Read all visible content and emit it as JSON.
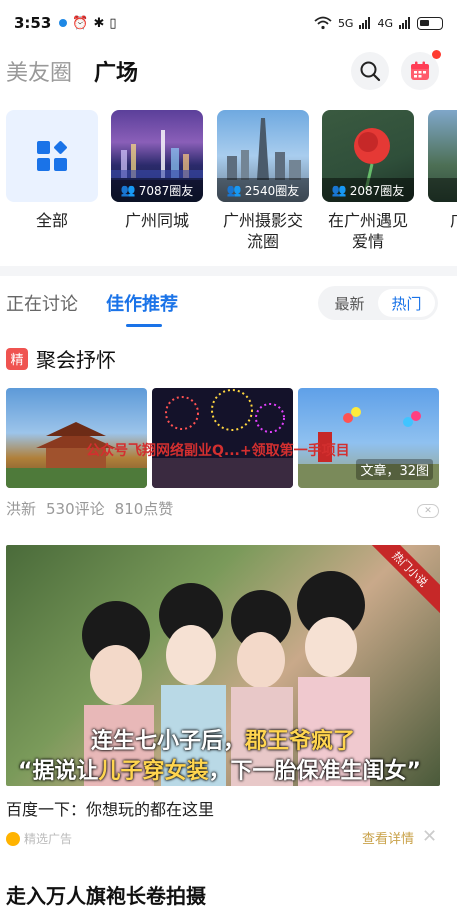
{
  "status_bar": {
    "time": "3:53",
    "network_5g": "5G",
    "network_4g": "4G"
  },
  "header": {
    "tab_friends": "美友圈",
    "tab_square": "广场"
  },
  "circles": [
    {
      "label": "全部",
      "count": ""
    },
    {
      "label": "广州同城",
      "count": "7087圈友"
    },
    {
      "label": "广州摄影交流圈",
      "count": "2540圈友"
    },
    {
      "label": "在广州遇见爱情",
      "count": "2087圈友"
    },
    {
      "label": "广州诗",
      "count": ""
    }
  ],
  "subtabs": {
    "discussing": "正在讨论",
    "featured": "佳作推荐",
    "sort_latest": "最新",
    "sort_hot": "热门"
  },
  "post": {
    "badge": "精",
    "title": "聚会抒怀",
    "overlay_text": "公众号飞翔网络副业Q...+领取第一手项目",
    "image_count": "文章，32图",
    "author": "洪新",
    "comments": "530评论",
    "likes": "810点赞"
  },
  "ad": {
    "ribbon": "热门小说",
    "caption_line1_a": "连生七小子后，",
    "caption_line1_b": "郡王爷疯了",
    "caption_line2_a": "“据说让",
    "caption_line2_b": "儿子穿女装",
    "caption_line2_c": "，下一胎保准生闺女”",
    "text": "百度一下：你想玩的都在这里",
    "source": "精选广告",
    "detail": "查看详情"
  },
  "next_post": {
    "title": "走入万人旗袍长卷拍摄"
  }
}
